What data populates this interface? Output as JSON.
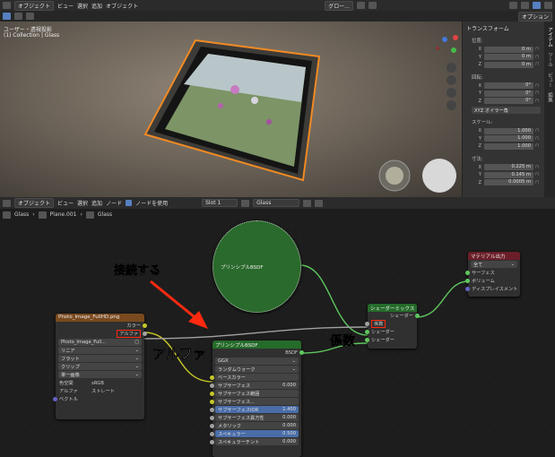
{
  "top_bar": {
    "menu_items": [
      "オブジェクト",
      "ビュー",
      "選択",
      "追加",
      "オブジェクト"
    ],
    "transform_dropdown": "グロー...",
    "options_label": "オプション"
  },
  "viewport": {
    "view_name": "ユーザー・透視投影",
    "collection_path": "(1) Collection | Glass"
  },
  "npanel": {
    "header": "トランスフォーム",
    "location_label": "位置:",
    "location": [
      {
        "axis": "X",
        "value": "0 m"
      },
      {
        "axis": "Y",
        "value": "0 m"
      },
      {
        "axis": "Z",
        "value": "0 m"
      }
    ],
    "rotation_label": "回転:",
    "rotation": [
      {
        "axis": "X",
        "value": "0°"
      },
      {
        "axis": "Y",
        "value": "0°"
      },
      {
        "axis": "Z",
        "value": "0°"
      }
    ],
    "rotation_mode": "XYZ オイラー角",
    "scale_label": "スケール:",
    "scale": [
      {
        "axis": "X",
        "value": "1.000"
      },
      {
        "axis": "Y",
        "value": "1.000"
      },
      {
        "axis": "Z",
        "value": "1.000"
      }
    ],
    "dimensions_label": "寸法:",
    "dimensions": [
      {
        "axis": "X",
        "value": "0.225 m"
      },
      {
        "axis": "Y",
        "value": "0.145 m"
      },
      {
        "axis": "Z",
        "value": "0.0005 m"
      }
    ],
    "tabs": [
      "アイテム",
      "ツール",
      "ビュー",
      "編集"
    ]
  },
  "node_header": {
    "mode": "オブジェクト",
    "menu_items": [
      "ビュー",
      "選択",
      "追加",
      "ノード"
    ],
    "use_nodes_label": "ノードを使用",
    "slot": "Slot 1",
    "material": "Glass"
  },
  "breadcrumb": {
    "items": [
      "Glass",
      "Plane.001",
      "Glass"
    ]
  },
  "nodes": {
    "image_texture": {
      "title": "Photo_Image_FullHD.png",
      "out_color": "カラー",
      "out_alpha": "アルファ",
      "image_name": "Photo_Image_Full...",
      "interpolation": "リニア",
      "projection": "フラット",
      "extension": "クリップ",
      "source": "単一画像",
      "colorspace_label": "色空間",
      "colorspace": "sRGB",
      "alpha_label": "アルファ",
      "alpha_mode": "ストレート",
      "in_vector": "ベクトル"
    },
    "principled_collapsed": {
      "title": "プリンシプルBSDF"
    },
    "principled": {
      "title": "プリンシプルBSDF",
      "output": "BSDF",
      "distribution": "GGX",
      "subsurface_method": "ランダムウォーク",
      "inputs": [
        {
          "name": "ベースカラー",
          "value": ""
        },
        {
          "name": "サブサーフェス",
          "value": "0.000"
        },
        {
          "name": "サブサーフェス範囲",
          "value": ""
        },
        {
          "name": "サブサーフェス...",
          "value": ""
        },
        {
          "name": "サブサーフェスIOR",
          "value": "1.400"
        },
        {
          "name": "サブサーフェス異方性",
          "value": "0.000"
        },
        {
          "name": "メタリック",
          "value": "0.000"
        },
        {
          "name": "スペキュラー",
          "value": "0.500"
        },
        {
          "name": "スペキュラーチント",
          "value": "0.000"
        }
      ]
    },
    "mix_shader": {
      "title": "シェーダーミックス",
      "output": "シェーダー",
      "in_fac": "係数",
      "in_shader1": "シェーダー",
      "in_shader2": "シェーダー"
    },
    "material_output": {
      "title": "マテリアル出力",
      "target": "全て",
      "in_surface": "サーフェス",
      "in_volume": "ボリューム",
      "in_displacement": "ディスプレイスメント"
    }
  },
  "annotations": {
    "connect": "接続する",
    "alpha": "アルファ",
    "factor": "係数"
  },
  "colors": {
    "accent": "#ff2a10",
    "node_shader_header": "#256b2a",
    "node_texture_header": "#7a4a1e",
    "node_output_header": "#6b1e28",
    "socket_yellow": "#c7c729",
    "socket_green": "#5ec75e",
    "socket_purple": "#6363c7",
    "socket_gray": "#a1a1a1"
  }
}
